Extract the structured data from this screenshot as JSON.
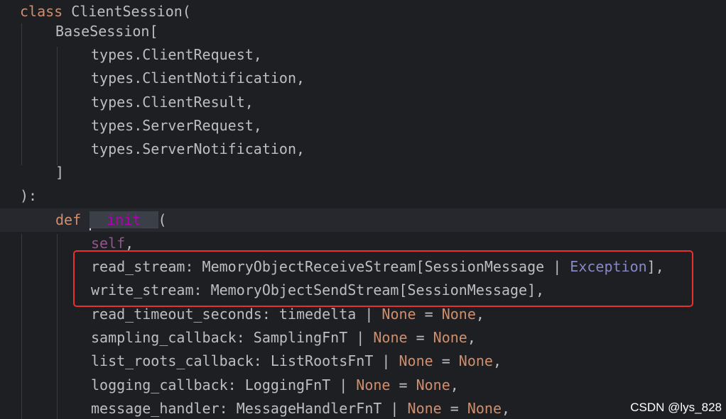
{
  "code": {
    "l1_kw": "class",
    "l1_rest": " ClientSession(",
    "l2": "BaseSession[",
    "l3": "types.ClientRequest,",
    "l4": "types.ClientNotification,",
    "l5": "types.ClientResult,",
    "l6": "types.ServerRequest,",
    "l7": "types.ServerNotification,",
    "l8": "]",
    "l9": "):",
    "l10_kw": "def",
    "l10_name": "__init__",
    "l10_rest": "(",
    "l11_self": "self",
    "l11_rest": ",",
    "l12_pre": "read_stream: MemoryObjectReceiveStream[SessionMessage | ",
    "l12_builtin": "Exception",
    "l12_post": "],",
    "l13": "write_stream: MemoryObjectSendStream[SessionMessage],",
    "l14_pre": "read_timeout_seconds: timedelta | ",
    "l14_none1": "None",
    "l14_eq": " = ",
    "l14_none2": "None",
    "l14_post": ",",
    "l15_pre": "sampling_callback: SamplingFnT | ",
    "l15_none1": "None",
    "l15_eq": " = ",
    "l15_none2": "None",
    "l15_post": ",",
    "l16_pre": "list_roots_callback: ListRootsFnT | ",
    "l16_none1": "None",
    "l16_eq": " = ",
    "l16_none2": "None",
    "l16_post": ",",
    "l17_pre": "logging_callback: LoggingFnT | ",
    "l17_none1": "None",
    "l17_eq": " = ",
    "l17_none2": "None",
    "l17_post": ",",
    "l18_pre": "message_handler: MessageHandlerFnT | ",
    "l18_none1": "None",
    "l18_eq": " = ",
    "l18_none2": "None",
    "l18_post": ","
  },
  "watermark": "CSDN @lys_828",
  "colors": {
    "background": "#1e1f22",
    "text": "#bcbec4",
    "keyword": "#cf8e6d",
    "self": "#94558d",
    "dunder": "#b200b2",
    "builtin": "#8888c6",
    "highlight_box": "#e8312f"
  }
}
